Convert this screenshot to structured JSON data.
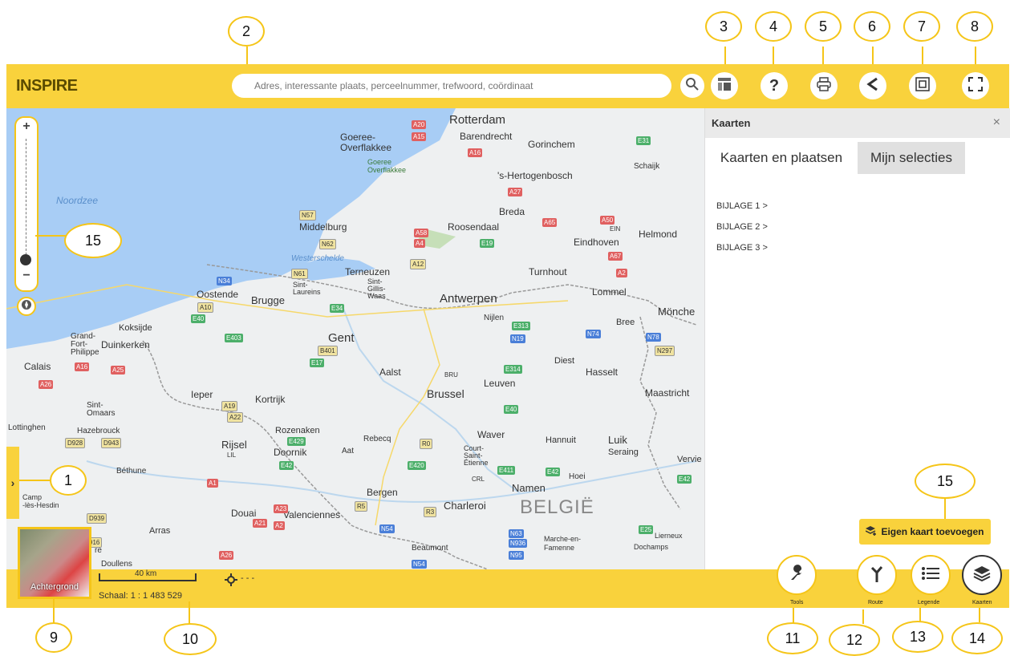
{
  "app": {
    "logo": "INSPIRE"
  },
  "search": {
    "placeholder": "Adres, interessante plaats, perceelnummer, trefwoord, coördinaat"
  },
  "toolbar": {
    "icons": [
      "search-icon",
      "layout-icon",
      "help-icon",
      "print-icon",
      "share-icon",
      "frame-icon",
      "fullscreen-icon"
    ]
  },
  "callouts": {
    "c1": "1",
    "c2": "2",
    "c3": "3",
    "c4": "4",
    "c5": "5",
    "c6": "6",
    "c7": "7",
    "c8": "8",
    "c9": "9",
    "c10": "10",
    "c11": "11",
    "c12": "12",
    "c13": "13",
    "c14": "14",
    "c15a": "15",
    "c15b": "15"
  },
  "map": {
    "sea_label": "Noordzee",
    "cities": {
      "rotterdam": "Rotterdam",
      "barendrecht": "Barendrecht",
      "gorinchem": "Gorinchem",
      "goeree": "Goeree-\nOverflakkee",
      "goeree2": "Goeree\nOverflakkee",
      "hertogenbosch": "'s-Hertogenbosch",
      "schaijk": "Schaijk",
      "breda": "Breda",
      "middelburg": "Middelburg",
      "roosendaal": "Roosendaal",
      "eindhoven": "Eindhoven",
      "helmond": "Helmond",
      "ein": "EIN",
      "westerschelde": "Westerschelde",
      "terneuzen": "Terneuzen",
      "sintgillis": "Sint-\nGillis-\nWaas",
      "turnhout": "Turnhout",
      "oostende": "Oostende",
      "brugge": "Brugge",
      "sintlaureins": "Sint-\nLaureins",
      "antwerpen": "Antwerpen",
      "lommel": "Lommel",
      "monchen": "Mönche",
      "nijlen": "Nijlen",
      "koksijde": "Koksijde",
      "grandfort": "Grand-\nFort-\nPhilippe",
      "duinkerken": "Duinkerken",
      "gent": "Gent",
      "bree": "Bree",
      "calais": "Calais",
      "diest": "Diest",
      "aalst": "Aalst",
      "hasselt": "Hasselt",
      "bru": "BRU",
      "leuven": "Leuven",
      "brussel": "Brussel",
      "ieper": "Ieper",
      "kortrijk": "Kortrijk",
      "maastricht": "Maastricht",
      "sintomaars": "Sint-\nOmaars",
      "lottinghen": "Lottinghen",
      "hazebrouck": "Hazebrouck",
      "rozenaken": "Rozenaken",
      "rebecq": "Rebecq",
      "waver": "Waver",
      "hannuit": "Hannuit",
      "luik": "Luik",
      "rijsel": "Rijsel",
      "doornik": "Doornik",
      "aat": "Aat",
      "courtsaint": "Court-\nSaint-\nÉtienne",
      "seraing": "Seraing",
      "gry": "gry",
      "lil": "LIL",
      "bethune": "Béthune",
      "verviers": "Vervie",
      "crl": "CRL",
      "namen": "Namen",
      "hoei": "Hoei",
      "camp": "Camp\n-lès-Hesdin",
      "bergen": "Bergen",
      "charleroi": "Charleroi",
      "douai": "Douai",
      "valenciennes": "Valenciennes",
      "belgie": "BELGIË",
      "arras": "Arras",
      "marche": "Marche-en-\nFamenne",
      "lierneux": "Lierneux",
      "dochamps": "Dochamps",
      "beaumont": "Beaumont",
      "doullens": "Doullens",
      "re": "re"
    },
    "roads": {
      "a20": "A20",
      "a15": "A15",
      "a16": "A16",
      "e31": "E31",
      "a27": "A27",
      "n57": "N57",
      "a65": "A65",
      "a50": "A50",
      "a58": "A58",
      "a4": "A4",
      "e19": "E19",
      "n62": "N62",
      "a67": "A67",
      "a12": "A12",
      "a2": "A2",
      "n61": "N61",
      "n34": "N34",
      "a10": "A10",
      "e40": "E40",
      "e34": "E34",
      "e313": "E313",
      "n19": "N19",
      "n74": "N74",
      "n78": "N78",
      "e403": "E403",
      "b401": "B401",
      "n297": "N297",
      "e17": "E17",
      "a16b": "A16",
      "a25": "A25",
      "e314": "E314",
      "a26": "A26",
      "a19": "A19",
      "a22": "A22",
      "e40b": "E40",
      "d928": "D928",
      "d943": "D943",
      "e429": "E429",
      "r0": "R0",
      "e42": "E42",
      "e411": "E411",
      "e420": "E420",
      "e42b": "E42",
      "e42c": "E42",
      "a1": "A1",
      "r5": "R5",
      "r3": "R3",
      "a23": "A23",
      "a21": "A21",
      "a2b": "A2",
      "d939": "D939",
      "n54": "N54",
      "n63": "N63",
      "n936": "N936",
      "n95": "N95",
      "e25": "E25",
      "a26b": "A26",
      "d916": "916",
      "n54b": "N54"
    },
    "background_label": "Achtergrond",
    "scale_bar": "40 km",
    "scale_text": "Schaal: 1 : 1 483 529",
    "coords": "- - -"
  },
  "panel": {
    "title": "Kaarten",
    "close": "×",
    "tabs": [
      "Kaarten en plaatsen",
      "Mijn selecties"
    ],
    "items": [
      "BIJLAGE 1 >",
      "BIJLAGE 2 >",
      "BIJLAGE 3 >"
    ],
    "add_button": "Eigen kaart toevoegen"
  },
  "bottom": {
    "buttons": [
      {
        "label": "Tools",
        "icon": "wrench-icon"
      },
      {
        "label": "Route",
        "icon": "route-icon"
      },
      {
        "label": "Legende",
        "icon": "list-icon"
      },
      {
        "label": "Kaarten",
        "icon": "layers-icon"
      }
    ]
  },
  "zoom": {
    "plus": "+",
    "minus": "−"
  }
}
